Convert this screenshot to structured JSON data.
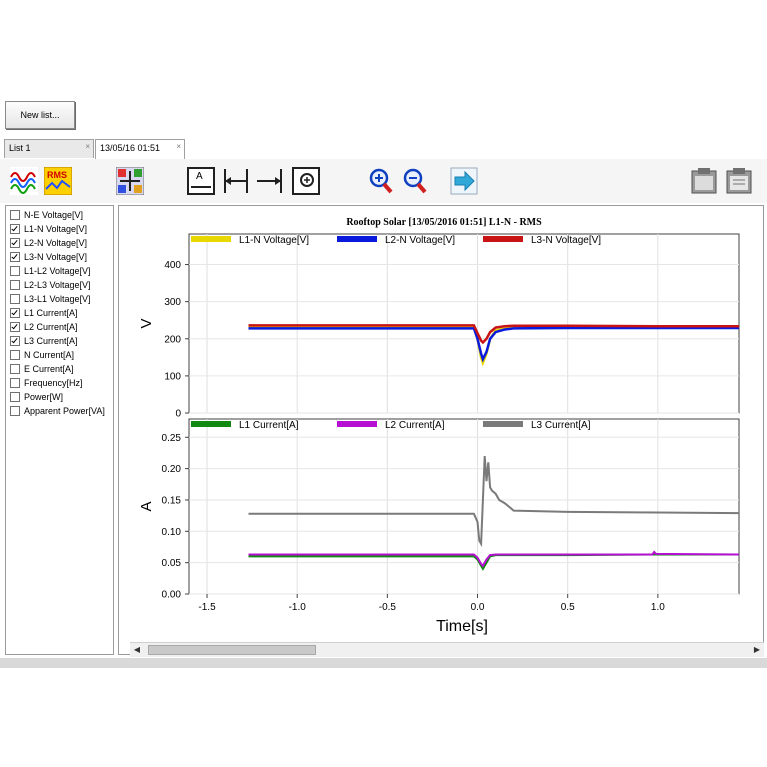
{
  "toolbar": {
    "new_list_label": "New list..."
  },
  "tabs": [
    {
      "label": "List 1",
      "close": "×"
    },
    {
      "label": "13/05/16 01:51",
      "close": "×"
    }
  ],
  "channels": [
    {
      "label": "N-E Voltage[V]",
      "checked": false
    },
    {
      "label": "L1-N Voltage[V]",
      "checked": true
    },
    {
      "label": "L2-N Voltage[V]",
      "checked": true
    },
    {
      "label": "L3-N Voltage[V]",
      "checked": true
    },
    {
      "label": "L1-L2 Voltage[V]",
      "checked": false
    },
    {
      "label": "L2-L3 Voltage[V]",
      "checked": false
    },
    {
      "label": "L3-L1 Voltage[V]",
      "checked": false
    },
    {
      "label": "L1 Current[A]",
      "checked": true
    },
    {
      "label": "L2 Current[A]",
      "checked": true
    },
    {
      "label": "L3 Current[A]",
      "checked": true
    },
    {
      "label": "N Current[A]",
      "checked": false
    },
    {
      "label": "E Current[A]",
      "checked": false
    },
    {
      "label": "Frequency[Hz]",
      "checked": false
    },
    {
      "label": "Power[W]",
      "checked": false
    },
    {
      "label": "Apparent Power[VA]",
      "checked": false
    }
  ],
  "chart_data": [
    {
      "type": "line",
      "title": "Rooftop Solar [13/05/2016 01:51] L1-N - RMS",
      "ylabel": "V",
      "xlabel": "",
      "xlim": [
        -1.6,
        1.45
      ],
      "ylim": [
        0,
        450
      ],
      "yticks": [
        "0",
        "100",
        "200",
        "300",
        "400"
      ],
      "grid": true,
      "legend_position": "top",
      "series": [
        {
          "name": "L1-N Voltage[V]",
          "color": "#e8d800",
          "x": [
            -1.27,
            -0.02,
            0.0,
            0.02,
            0.03,
            0.05,
            0.07,
            0.1,
            0.15,
            0.2,
            0.5,
            1.0,
            1.45
          ],
          "y": [
            232,
            232,
            200,
            150,
            135,
            160,
            200,
            222,
            228,
            230,
            231,
            231,
            231
          ]
        },
        {
          "name": "L2-N Voltage[V]",
          "color": "#0a1adc",
          "x": [
            -1.27,
            -0.02,
            0.0,
            0.02,
            0.03,
            0.05,
            0.07,
            0.1,
            0.15,
            0.2,
            0.5,
            1.0,
            1.45
          ],
          "y": [
            228,
            228,
            200,
            160,
            145,
            165,
            200,
            218,
            225,
            228,
            229,
            229,
            229
          ]
        },
        {
          "name": "L3-N Voltage[V]",
          "color": "#c81414",
          "x": [
            -1.27,
            -0.02,
            0.0,
            0.02,
            0.03,
            0.05,
            0.07,
            0.1,
            0.15,
            0.2,
            0.5,
            1.0,
            1.45
          ],
          "y": [
            236,
            236,
            215,
            195,
            190,
            200,
            218,
            230,
            234,
            235,
            235,
            234,
            234
          ]
        }
      ]
    },
    {
      "type": "line",
      "title": "",
      "ylabel": "A",
      "xlabel": "Time[s]",
      "xlim": [
        -1.6,
        1.45
      ],
      "ylim": [
        0,
        0.26
      ],
      "xticks": [
        "-1.5",
        "-1.0",
        "-0.5",
        "0.0",
        "0.5",
        "1.0"
      ],
      "yticks": [
        "0.00",
        "0.05",
        "0.10",
        "0.15",
        "0.20",
        "0.25"
      ],
      "grid": true,
      "legend_position": "top",
      "series": [
        {
          "name": "L1 Current[A]",
          "color": "#108a10",
          "x": [
            -1.27,
            -0.02,
            0.0,
            0.02,
            0.03,
            0.05,
            0.07,
            0.1,
            0.2,
            0.5,
            1.0,
            1.45
          ],
          "y": [
            0.06,
            0.06,
            0.055,
            0.045,
            0.04,
            0.05,
            0.06,
            0.062,
            0.062,
            0.062,
            0.063,
            0.063
          ]
        },
        {
          "name": "L2 Current[A]",
          "color": "#b40fd2",
          "x": [
            -1.27,
            -0.02,
            0.0,
            0.02,
            0.03,
            0.05,
            0.07,
            0.1,
            0.2,
            0.5,
            0.97,
            0.98,
            0.99,
            1.45
          ],
          "y": [
            0.063,
            0.063,
            0.058,
            0.048,
            0.045,
            0.055,
            0.062,
            0.063,
            0.063,
            0.063,
            0.063,
            0.067,
            0.064,
            0.063
          ]
        },
        {
          "name": "L3 Current[A]",
          "color": "#7a7a7a",
          "x": [
            -1.27,
            -0.02,
            0.0,
            0.01,
            0.02,
            0.03,
            0.04,
            0.05,
            0.06,
            0.07,
            0.08,
            0.1,
            0.12,
            0.15,
            0.18,
            0.2,
            0.5,
            1.0,
            1.45
          ],
          "y": [
            0.128,
            0.128,
            0.115,
            0.085,
            0.08,
            0.15,
            0.22,
            0.18,
            0.21,
            0.17,
            0.165,
            0.16,
            0.15,
            0.145,
            0.138,
            0.133,
            0.131,
            0.13,
            0.129
          ]
        }
      ]
    }
  ]
}
